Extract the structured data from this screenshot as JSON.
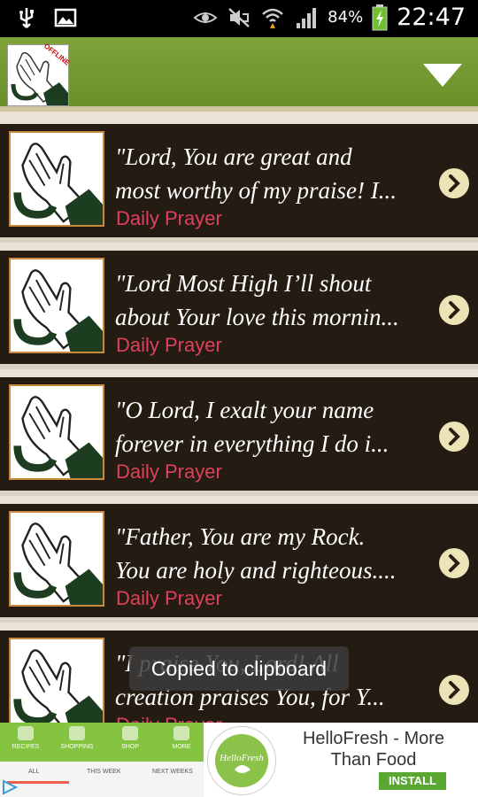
{
  "status_bar": {
    "battery_percent": "84%",
    "time": "22:47",
    "icons": [
      "usb-icon",
      "image-icon",
      "eye-icon",
      "mute-icon",
      "wifi-icon",
      "signal-icon",
      "battery-charging-icon"
    ]
  },
  "header": {
    "offline_label": "OFFLINE",
    "menu_icon": "dropdown-triangle-icon"
  },
  "items": [
    {
      "line1": "\"Lord, You are great and",
      "line2": "most worthy of my praise! I...",
      "category": "Daily Prayer"
    },
    {
      "line1": "\"Lord Most High I’ll shout",
      "line2": "about Your love this mornin...",
      "category": "Daily Prayer"
    },
    {
      "line1": "\"O Lord, I exalt your name",
      "line2": "forever in everything I do i...",
      "category": "Daily Prayer"
    },
    {
      "line1": "\"Father, You are my Rock.",
      "line2": "You are holy and righteous....",
      "category": "Daily Prayer"
    },
    {
      "line1": "\"I praise You, Lord! All",
      "line2": "creation praises You, for Y...",
      "category": "Daily Prayer"
    }
  ],
  "toast": "Copied to clipboard",
  "ad": {
    "title": "HelloFresh - More Than Food",
    "button": "INSTALL",
    "logo_text": "HelloFresh",
    "app_tabs": [
      "RECIPES",
      "SHOPPING",
      "SHOP",
      "MORE"
    ],
    "app_subtabs": [
      "ALL",
      "THIS WEEK",
      "NEXT WEEKS"
    ],
    "colors": {
      "accent": "#84c441",
      "install": "#5aa832"
    }
  },
  "colors": {
    "header": "#7fa33a",
    "row_bg": "#241b12",
    "category": "#e0405a",
    "chevron_bg": "#ece3b6"
  }
}
